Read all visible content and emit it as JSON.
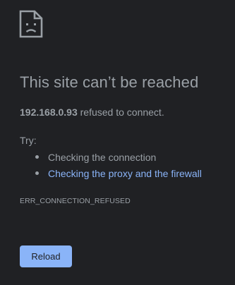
{
  "page": {
    "icon": "sad-page-icon",
    "title": "This site can’t be reached",
    "message_host": "192.168.0.93",
    "message_rest": " refused to connect.",
    "try_label": "Try:",
    "suggestions": [
      {
        "label": "Checking the connection",
        "is_link": false
      },
      {
        "label": "Checking the proxy and the firewall",
        "is_link": true
      }
    ],
    "error_code": "ERR_CONNECTION_REFUSED",
    "reload_label": "Reload"
  },
  "colors": {
    "background": "#202124",
    "text": "#9aa0a6",
    "link": "#8ab4f8",
    "button_background": "#8ab4f8",
    "button_text": "#202124"
  }
}
